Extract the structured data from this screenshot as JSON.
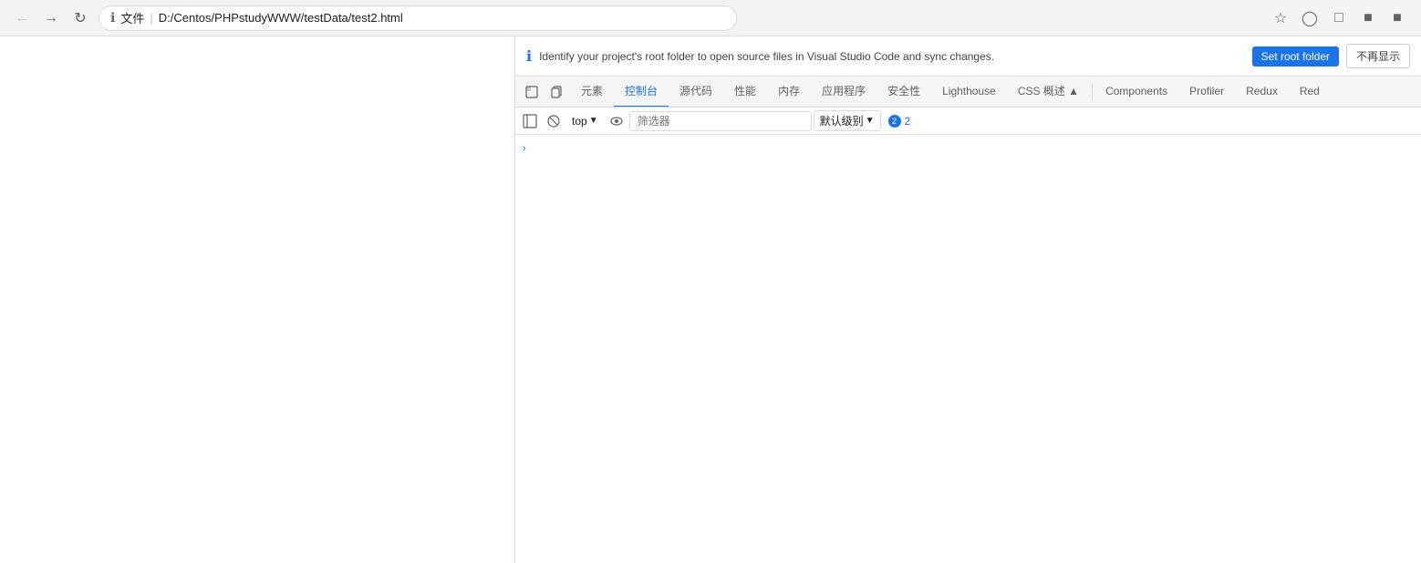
{
  "browser": {
    "back_btn": "◀",
    "forward_btn": "▶",
    "reload_btn": "↻",
    "info_label": "文件",
    "url": "D:/Centos/PHPstudyWWW/testData/test2.html",
    "bookmark_icon": "★",
    "extensions_icon": "⬡",
    "window_icon": "⬜",
    "minimize_icon": "—",
    "close_icon": "✕"
  },
  "banner": {
    "text": "Identify your project's root folder to open source files in Visual Studio Code and sync changes.",
    "set_root_label": "Set root folder",
    "dismiss_label": "不再显示"
  },
  "devtools": {
    "tabs": [
      {
        "id": "inspector",
        "label": "⬜",
        "icon": true
      },
      {
        "id": "copy",
        "label": "⬡",
        "icon": true
      },
      {
        "id": "elements",
        "label": "元素"
      },
      {
        "id": "console",
        "label": "控制台",
        "active": true
      },
      {
        "id": "sources",
        "label": "源代码"
      },
      {
        "id": "performance",
        "label": "性能"
      },
      {
        "id": "memory",
        "label": "内存"
      },
      {
        "id": "application",
        "label": "应用程序"
      },
      {
        "id": "security",
        "label": "安全性"
      },
      {
        "id": "lighthouse",
        "label": "Lighthouse"
      },
      {
        "id": "css-overview",
        "label": "CSS 概述 ▲"
      },
      {
        "id": "components",
        "label": "Components"
      },
      {
        "id": "profiler",
        "label": "Profiler"
      },
      {
        "id": "redux",
        "label": "Redux"
      },
      {
        "id": "red",
        "label": "Red"
      }
    ]
  },
  "console_toolbar": {
    "sidebar_icon": "◫",
    "clear_icon": "⊘",
    "top_label": "top",
    "eye_icon": "👁",
    "filter_placeholder": "筛选器",
    "level_label": "默认级别",
    "issues_count": "2"
  },
  "console_content": {
    "row1_arrow": "›"
  }
}
